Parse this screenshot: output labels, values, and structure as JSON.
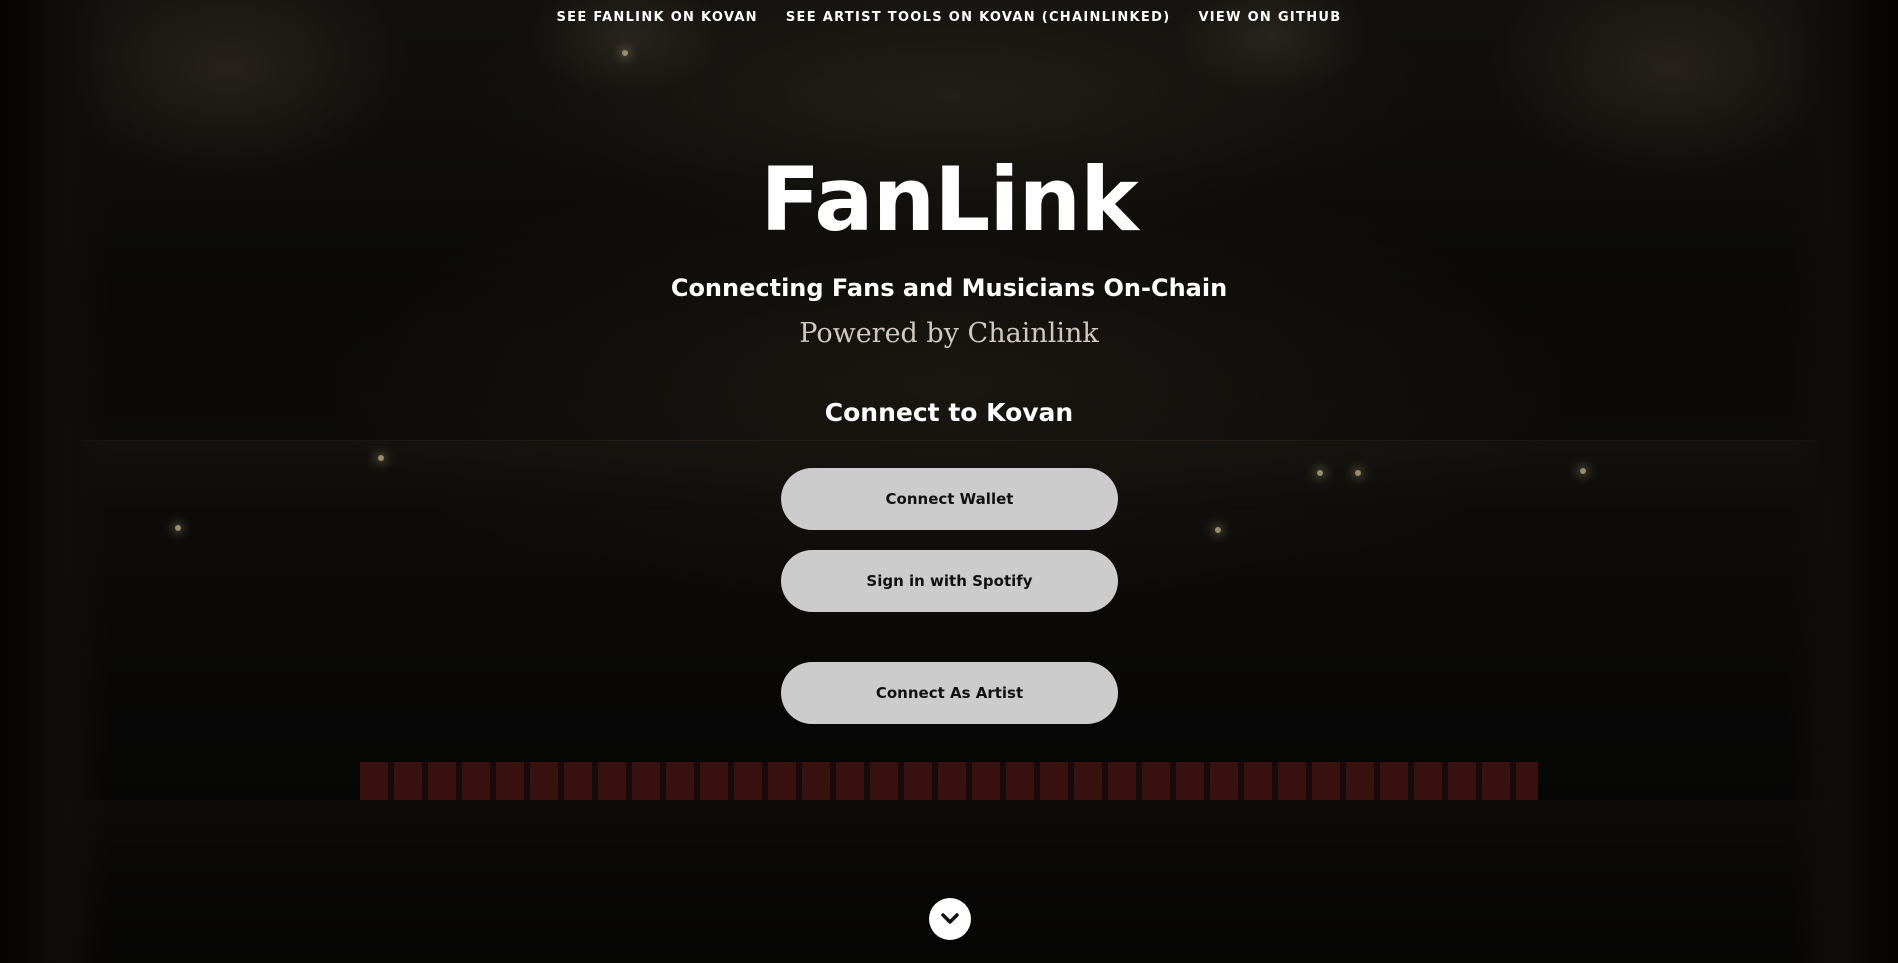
{
  "nav": {
    "items": [
      {
        "label": "SEE FANLINK ON KOVAN"
      },
      {
        "label": "SEE ARTIST TOOLS ON KOVAN (CHAINLINKED)"
      },
      {
        "label": "VIEW ON GITHUB"
      }
    ]
  },
  "hero": {
    "title": "FanLink",
    "subtitle": "Connecting Fans and Musicians On-Chain",
    "powered_by": "Powered by Chainlink",
    "connect_heading": "Connect to Kovan",
    "buttons": {
      "connect_wallet": "Connect Wallet",
      "spotify": "Sign in with Spotify",
      "artist": "Connect As Artist"
    },
    "scroll_icon": "chevron-down-icon"
  },
  "colors": {
    "button_bg": "#cccccc",
    "button_text": "#111111",
    "text_primary": "#ffffff",
    "text_secondary": "#cfc9c0"
  }
}
